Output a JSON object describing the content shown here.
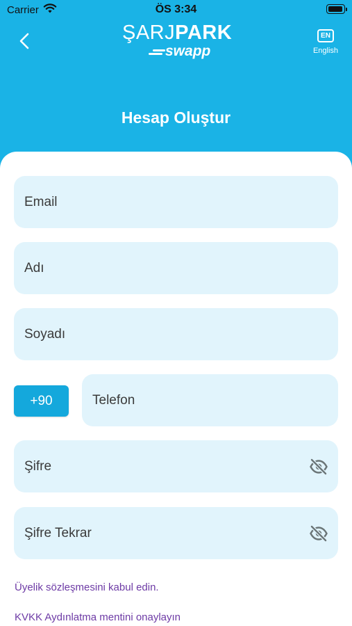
{
  "status_bar": {
    "carrier": "Carrier",
    "time": "ÖS 3:34"
  },
  "header": {
    "logo_light": "ŞARJ",
    "logo_bold": "PARK",
    "logo_sub": "swapp",
    "lang_code": "EN",
    "lang_label": "English",
    "title": "Hesap Oluştur"
  },
  "form": {
    "email_label": "Email",
    "name_label": "Adı",
    "surname_label": "Soyadı",
    "country_code": "+90",
    "phone_label": "Telefon",
    "password_label": "Şifre",
    "password_repeat_label": "Şifre Tekrar"
  },
  "links": {
    "membership": "Üyelik sözleşmesini kabul edin.",
    "kvkk": "KVKK Aydınlatma mentini onaylayın"
  },
  "colors": {
    "primary": "#1ab3e6",
    "field_bg": "#e1f4fc",
    "link": "#6d3aa5"
  },
  "icons": [
    "back-chevron-icon",
    "language-icon",
    "eye-off-icon",
    "wifi-icon",
    "battery-icon"
  ]
}
